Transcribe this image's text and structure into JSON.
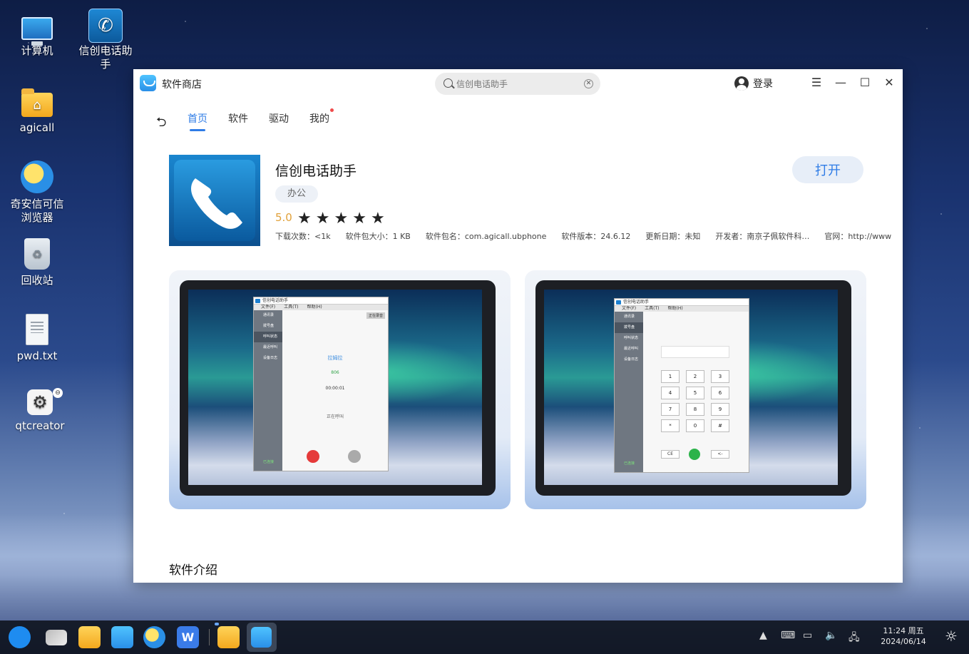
{
  "desktop": {
    "icons": [
      {
        "label": "计算机",
        "icon": "computer-icon"
      },
      {
        "label": "信创电话助手",
        "icon": "phone-app-icon"
      },
      {
        "label": "agicall",
        "icon": "home-folder-icon"
      },
      {
        "label": "奇安信可信浏览器",
        "icon": "browser-icon"
      },
      {
        "label": "回收站",
        "icon": "trash-icon"
      },
      {
        "label": "pwd.txt",
        "icon": "text-file-icon"
      },
      {
        "label": "qtcreator",
        "icon": "gear-icon"
      }
    ]
  },
  "window": {
    "title": "软件商店",
    "search": {
      "placeholder": "信创电话助手",
      "value": ""
    },
    "login_label": "登录",
    "controls": {
      "menu": "☰",
      "minimize": "—",
      "maximize": "☐",
      "close": "✕"
    }
  },
  "nav": {
    "back": "⮌",
    "tabs": [
      {
        "label": "首页",
        "active": true
      },
      {
        "label": "软件",
        "active": false
      },
      {
        "label": "驱动",
        "active": false
      },
      {
        "label": "我的",
        "active": false,
        "has_dot": true
      }
    ]
  },
  "app": {
    "name": "信创电话助手",
    "category": "办公",
    "rating": "5.0",
    "stars": 5,
    "open_label": "打开",
    "meta": [
      "下载次数：<1k",
      "软件包大小：1 KB",
      "软件包名：com.agicall.ubphone",
      "软件版本：24.6.12",
      "更新日期：未知",
      "开发者：南京子佩软件科…",
      "官网：http://www"
    ]
  },
  "screenshots": {
    "shot1": {
      "title": "信创电话助手",
      "menu": [
        "文件(F)",
        "工具(T)",
        "帮助(H)"
      ],
      "side": [
        "通讯录",
        "拨号盘",
        "呼叫状态",
        "最近呼叫",
        "设备日志"
      ],
      "footer": "已连接",
      "top_btn": "正在录音",
      "name": "拉姆拉",
      "number": "806",
      "timer": "00:00:01",
      "status": "正在呼叫"
    },
    "shot2": {
      "title": "信创电话助手",
      "menu": [
        "文件(F)",
        "工具(T)",
        "帮助(H)"
      ],
      "side": [
        "通讯录",
        "拨号盘",
        "呼叫状态",
        "最近呼叫",
        "设备日志"
      ],
      "footer": "已连接",
      "keys": [
        "1",
        "2",
        "3",
        "4",
        "5",
        "6",
        "7",
        "8",
        "9",
        "*",
        "0",
        "#"
      ],
      "ce": "CE",
      "backspace": "<-"
    }
  },
  "intro_heading": "软件介绍",
  "taskbar": {
    "clock_time": "11:24  周五",
    "clock_date": "2024/06/14"
  },
  "colors": {
    "accent": "#2f7ce6",
    "rating": "#e1a13a",
    "dot": "#f04b4b"
  }
}
